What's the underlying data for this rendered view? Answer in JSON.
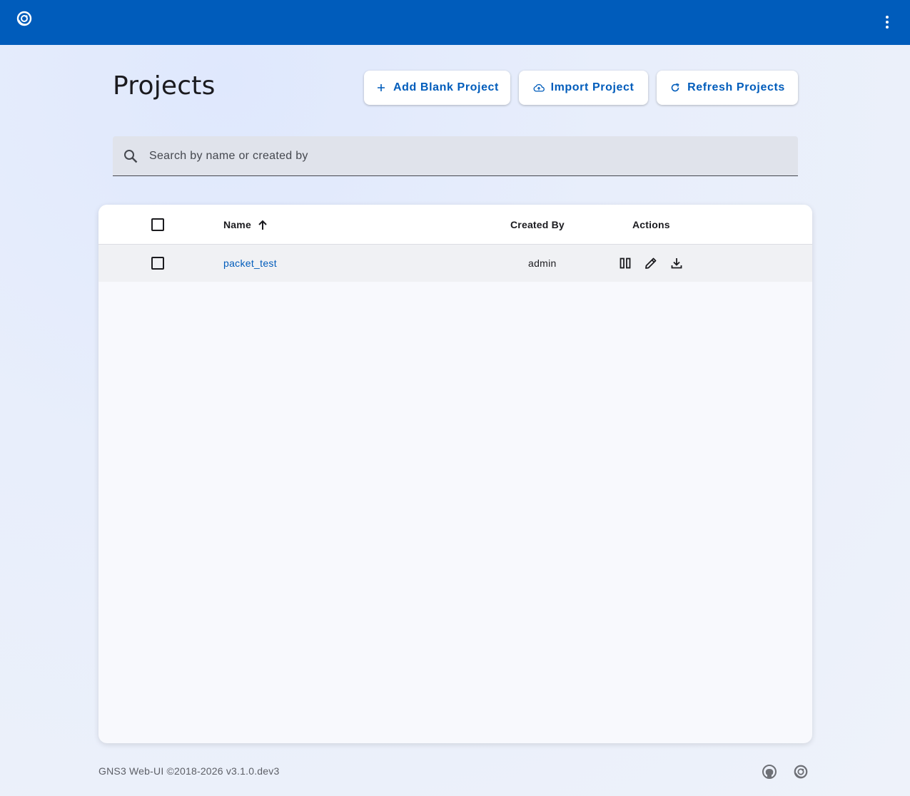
{
  "topbar": {
    "logo_icon": "gns3-chameleon-icon",
    "menu_icon": "more-vert-icon",
    "color": "#005cbb"
  },
  "page": {
    "title": "Projects"
  },
  "toolbar": {
    "add_label": "Add Blank Project",
    "add_icon": "plus-icon",
    "import_label": "Import Project",
    "import_icon": "cloud-upload-icon",
    "refresh_label": "Refresh Projects",
    "refresh_icon": "refresh-icon"
  },
  "search": {
    "placeholder": "Search by name or created by",
    "value": "",
    "icon": "search-icon"
  },
  "table": {
    "columns": {
      "name": "Name",
      "name_sort": "ascending",
      "created_by": "Created By",
      "actions": "Actions"
    },
    "rows": [
      {
        "name": "packet_test",
        "created_by": "admin",
        "actions": [
          "pause-icon",
          "edit-icon",
          "download-icon"
        ]
      }
    ]
  },
  "footer": {
    "text": "GNS3 Web-UI ©2018-2026 v3.1.0.dev3",
    "icons": [
      "github-icon",
      "gns3-chameleon-icon"
    ]
  }
}
